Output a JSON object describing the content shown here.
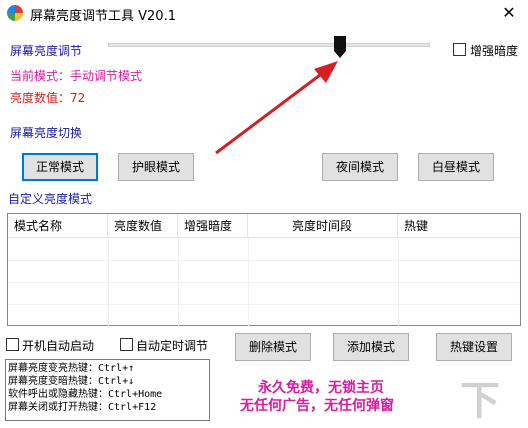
{
  "window": {
    "title": "屏幕亮度调节工具 V20.1",
    "close_glyph": "✕"
  },
  "brightness": {
    "section_label": "屏幕亮度调节",
    "current_mode_label": "当前模式：手动调节模式",
    "value_label": "亮度数值：72",
    "slider_value": 72,
    "slider_max": 100,
    "enhance_dark_label": "增强暗度",
    "enhance_dark_checked": false
  },
  "mode_switch": {
    "section_label": "屏幕亮度切换",
    "normal_label": "正常模式",
    "eye_label": "护眼模式",
    "night_label": "夜间模式",
    "day_label": "白昼模式"
  },
  "custom": {
    "section_label": "自定义亮度模式",
    "columns": [
      "模式名称",
      "亮度数值",
      "增强暗度",
      "亮度时间段",
      "热键"
    ]
  },
  "options": {
    "autostart_label": "开机自动启动",
    "autotimer_label": "自动定时调节",
    "delete_label": "删除模式",
    "add_label": "添加模式",
    "hotkey_settings_label": "热键设置"
  },
  "hotkeys": {
    "lines": [
      "屏幕亮度变亮热键：Ctrl+↑",
      "屏幕亮度变暗热键：Ctrl+↓",
      "软件呼出或隐藏热键：Ctrl+Home",
      "屏幕关闭或打开热键：Ctrl+F12"
    ]
  },
  "promo": {
    "line1": "永久免费，无锁主页",
    "line2": "无任何广告，无任何弹窗"
  },
  "colors": {
    "section_blue": "#1a1aa6",
    "mode_magenta": "#d81b9f",
    "value_red": "#d81b1b",
    "arrow_red": "#d42020",
    "active_border": "#0078d7"
  },
  "watermark": "下载吧"
}
